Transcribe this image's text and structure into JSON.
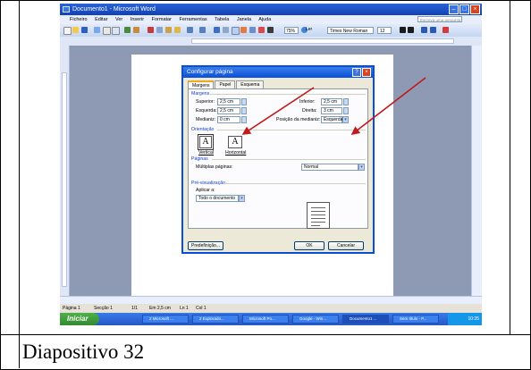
{
  "window": {
    "title": "Documento1 - Microsoft Word"
  },
  "menu": {
    "items": [
      "Ficheiro",
      "Editar",
      "Ver",
      "Inserir",
      "Formatar",
      "Ferramentas",
      "Tabela",
      "Janela",
      "Ajuda"
    ],
    "help_placeholder": "Escreva uma pergunta"
  },
  "toolbar": {
    "zoom": "75%",
    "read_label": "Ler",
    "font": "Times New Roman",
    "font_size": "12"
  },
  "dialog": {
    "title": "Configurar página",
    "tabs": [
      "Margens",
      "Papel",
      "Esquema"
    ],
    "margins_group": "Margens",
    "superior_label": "Superior:",
    "superior_value": "2,5 cm",
    "esquerda_label": "Esquerda:",
    "esquerda_value": "2,5 cm",
    "medianiz_label": "Medianiz:",
    "medianiz_value": "0 cm",
    "inferior_label": "Inferior:",
    "inferior_value": "2,5 cm",
    "direita_label": "Direita:",
    "direita_value": "3 cm",
    "pos_medianiz_label": "Posição da medianiz:",
    "pos_medianiz_value": "Esquerda",
    "orientation_group": "Orientação",
    "vertical_label": "Vertical",
    "horizontal_label": "Horizontal",
    "pages_group": "Páginas",
    "multiple_pages_label": "Múltiplas páginas:",
    "multiple_pages_value": "Normal",
    "preview_group": "Pré-visualização",
    "apply_label": "Aplicar a:",
    "apply_value": "Todo o documento",
    "default_button": "Predefinição...",
    "ok_button": "OK",
    "cancel_button": "Cancelar"
  },
  "status": {
    "page": "Página 1",
    "section": "Secção 1",
    "pages": "1/1",
    "at": "Em 2,5 cm",
    "line": "Ln 1",
    "col": "Col 1"
  },
  "taskbar": {
    "start": "Iniciar",
    "tasks": [
      "2 Microsoft ...",
      "2 Explorado...",
      "Microsoft Po...",
      "Google - Win...",
      "Documento1 ...",
      "Sem título - P..."
    ],
    "clock": "10:35"
  },
  "caption": "Diapositivo 32"
}
